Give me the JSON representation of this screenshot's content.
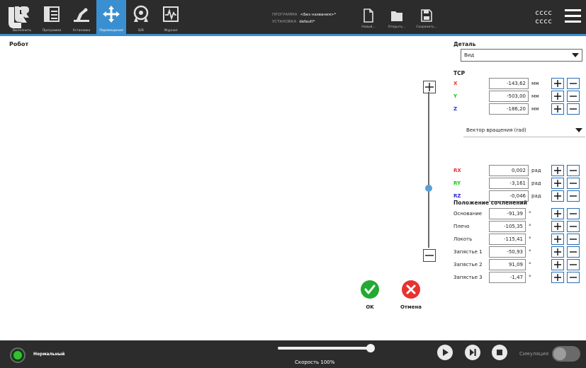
{
  "topbar": {
    "tabs": [
      {
        "label": "Выполнить",
        "icon": "run-icon"
      },
      {
        "label": "Программа",
        "icon": "program-icon"
      },
      {
        "label": "Установка",
        "icon": "installation-icon"
      },
      {
        "label": "Перемещения",
        "icon": "move-icon"
      },
      {
        "label": "В/В",
        "icon": "io-icon"
      },
      {
        "label": "Журнал",
        "icon": "log-icon"
      }
    ],
    "program_label": "ПРОГРАММА",
    "program_value": "<Без названия>*",
    "installation_label": "УСТАНОВКА",
    "installation_value": "default*",
    "file_buttons": [
      {
        "label": "Новый...",
        "icon": "new-file-icon"
      },
      {
        "label": "Открыть...",
        "icon": "folder-icon"
      },
      {
        "label": "Сохранить...",
        "icon": "save-icon"
      }
    ],
    "user_line1": "cccc",
    "user_line2": "cccc"
  },
  "main": {
    "robot_title": "Робот",
    "detail_title": "Деталь",
    "view_select": "Вид",
    "tcp_title": "TCP",
    "tcp": [
      {
        "axis": "X",
        "value": "-143,62",
        "unit": "мм",
        "color": "#e23030"
      },
      {
        "axis": "Y",
        "value": "-503,00",
        "unit": "мм",
        "color": "#1fbf1f"
      },
      {
        "axis": "Z",
        "value": "-186,20",
        "unit": "мм",
        "color": "#2a2ad0"
      }
    ],
    "orientation_select": "Вектор вращения (rad)",
    "rotation": [
      {
        "axis": "RX",
        "value": "0,002",
        "unit": "рад",
        "color": "#e23030"
      },
      {
        "axis": "RY",
        "value": "-3,161",
        "unit": "рад",
        "color": "#1fbf1f"
      },
      {
        "axis": "RZ",
        "value": "-0,046",
        "unit": "рад",
        "color": "#2a2ad0"
      }
    ],
    "joints_title": "Положение сочленений",
    "joints": [
      {
        "name": "Основание",
        "value": "-91,39",
        "unit": "°"
      },
      {
        "name": "Плечо",
        "value": "-105,35",
        "unit": "°"
      },
      {
        "name": "Локоть",
        "value": "-115,41",
        "unit": "°"
      },
      {
        "name": "Запястье 1",
        "value": "-50,93",
        "unit": "°"
      },
      {
        "name": "Запястье 2",
        "value": "91,09",
        "unit": "°"
      },
      {
        "name": "Запястье 3",
        "value": "-1,47",
        "unit": "°"
      }
    ],
    "ok_label": "OK",
    "cancel_label": "Отмена"
  },
  "bottombar": {
    "status": "Нормальный",
    "speed_label": "Скорость 100%",
    "speed_value": 1.0,
    "simulation_label": "Симуляция",
    "simulation_on": false
  }
}
